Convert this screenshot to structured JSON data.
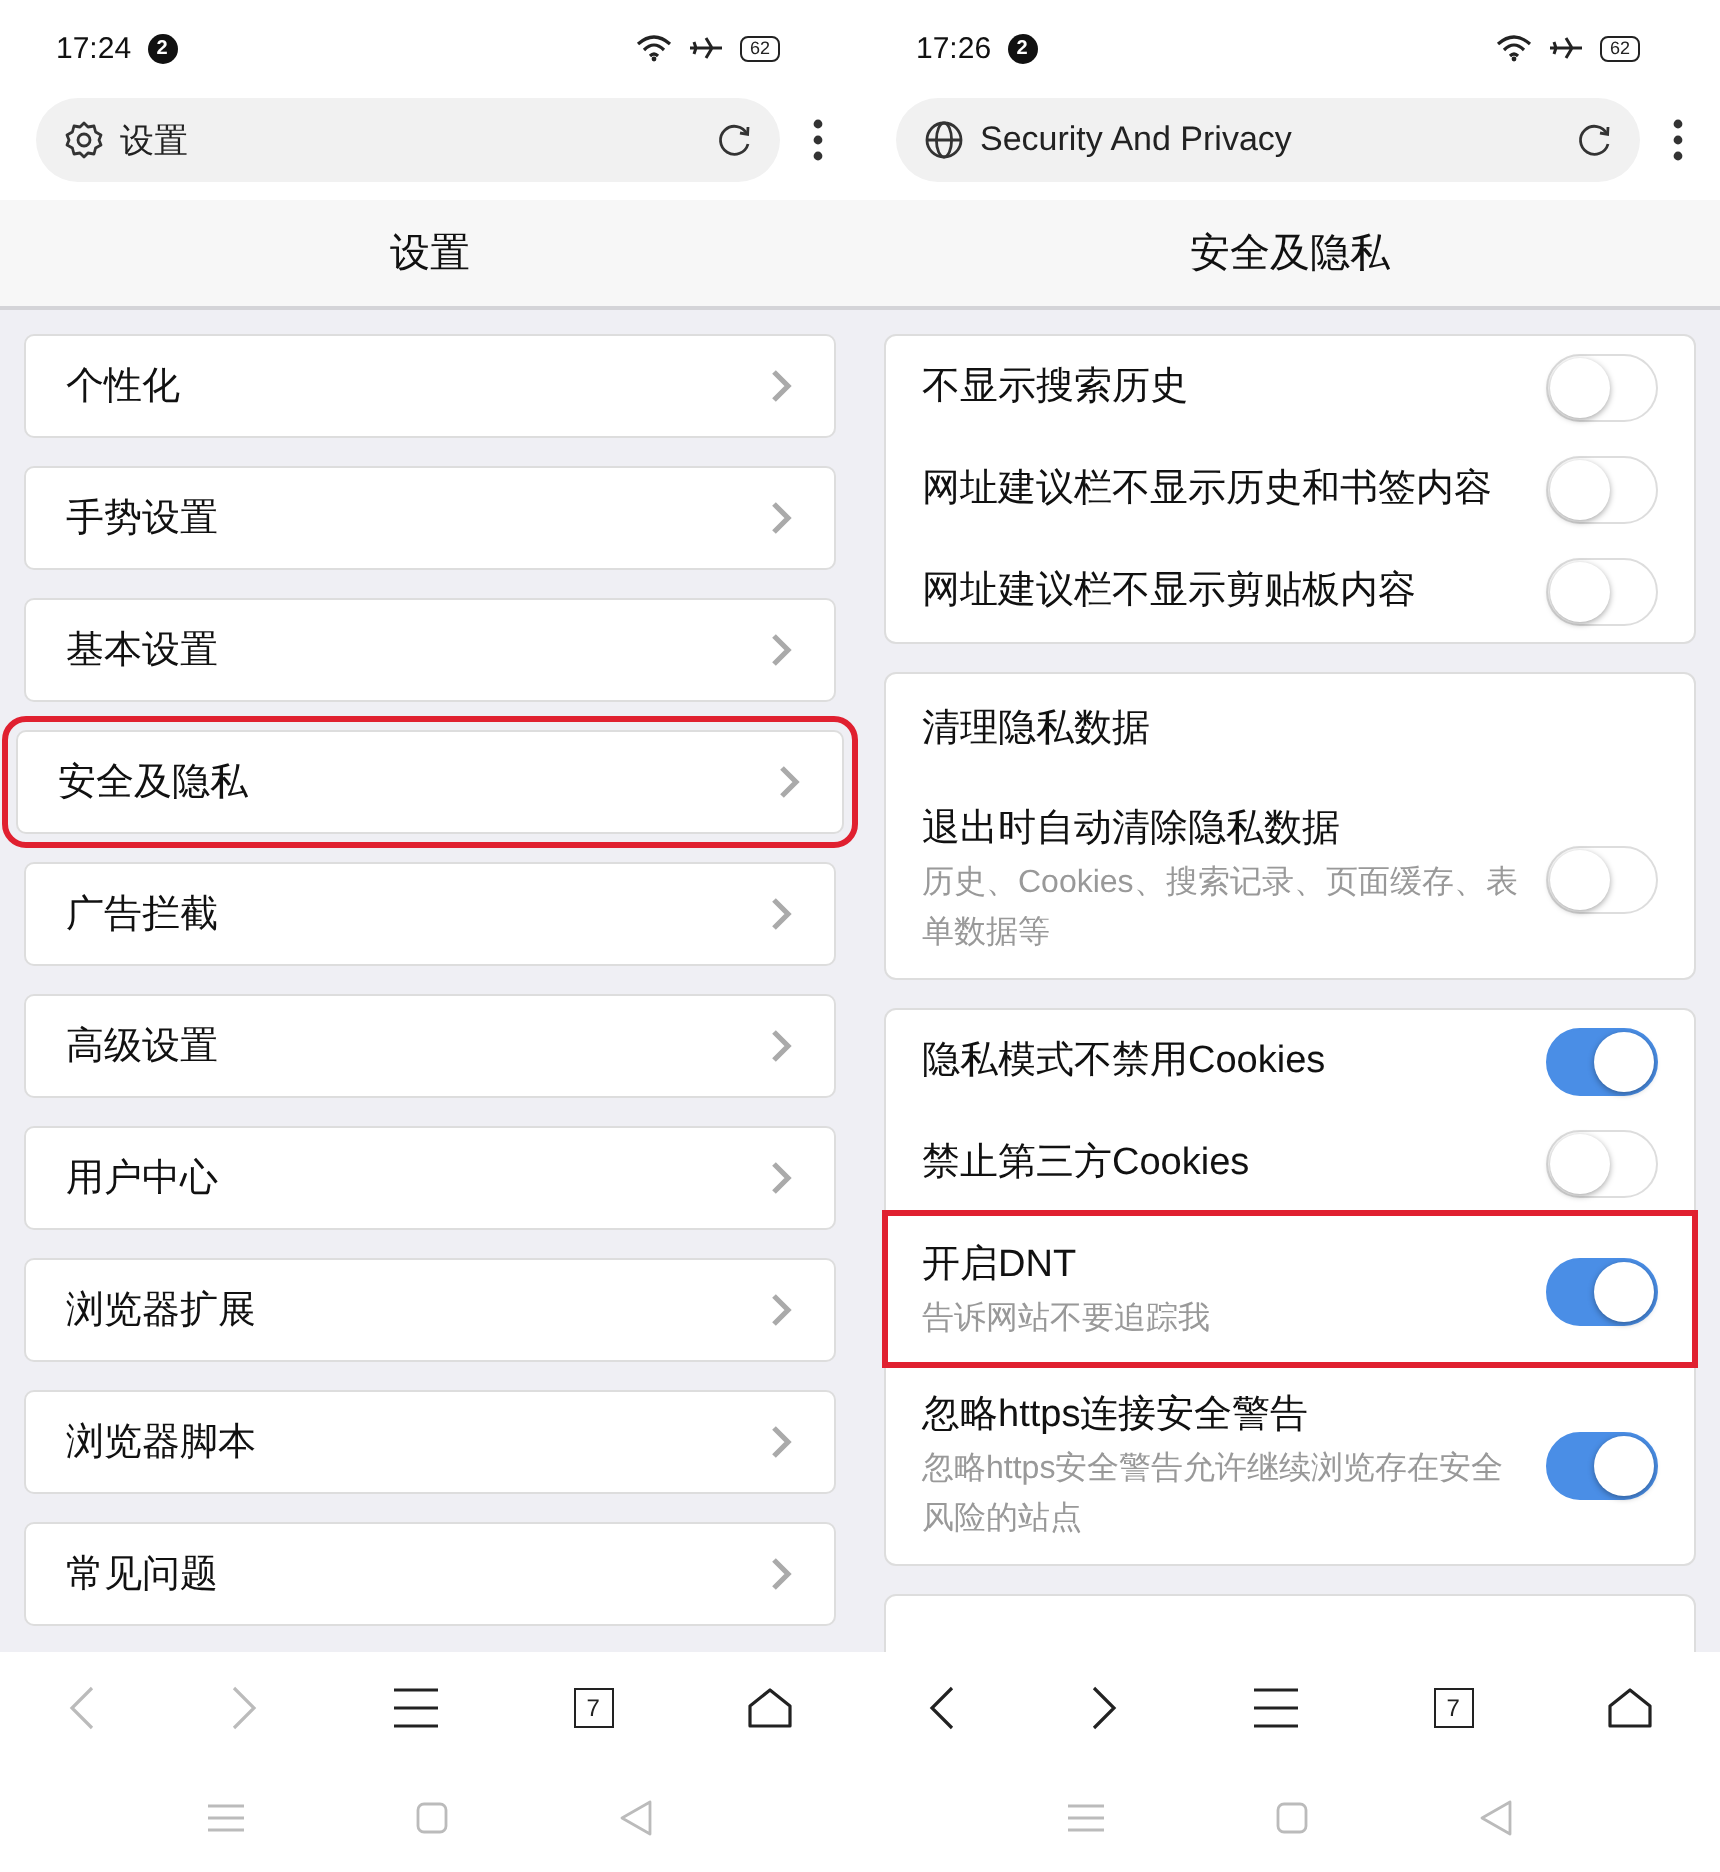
{
  "panels": [
    {
      "kind": "menu",
      "status_bar": {
        "time": "17:24",
        "notifications": "2",
        "battery": "62"
      },
      "address_bar": {
        "kind": "settings",
        "text": "设置"
      },
      "title": "设置",
      "menu_items": [
        {
          "label": "个性化",
          "highlighted": false
        },
        {
          "label": "手势设置",
          "highlighted": false
        },
        {
          "label": "基本设置",
          "highlighted": false
        },
        {
          "label": "安全及隐私",
          "highlighted": true
        },
        {
          "label": "广告拦截",
          "highlighted": false
        },
        {
          "label": "高级设置",
          "highlighted": false
        },
        {
          "label": "用户中心",
          "highlighted": false
        },
        {
          "label": "浏览器扩展",
          "highlighted": false
        },
        {
          "label": "浏览器脚本",
          "highlighted": false
        },
        {
          "label": "常见问题",
          "highlighted": false
        }
      ],
      "nav": {
        "back_enabled": false,
        "forward_enabled": false,
        "tab_count": "7"
      }
    },
    {
      "kind": "toggles",
      "status_bar": {
        "time": "17:26",
        "notifications": "2",
        "battery": "62"
      },
      "address_bar": {
        "kind": "web",
        "text": "Security And Privacy"
      },
      "title": "安全及隐私",
      "groups": [
        {
          "rows": [
            {
              "label": "不显示搜索历史",
              "on": false,
              "highlighted": false
            },
            {
              "label": "网址建议栏不显示历史和书签内容",
              "on": false,
              "highlighted": false
            },
            {
              "label": "网址建议栏不显示剪贴板内容",
              "on": false,
              "highlighted": false
            }
          ]
        },
        {
          "heading": "清理隐私数据",
          "rows": [
            {
              "label": "退出时自动清除隐私数据",
              "description": "历史、Cookies、搜索记录、页面缓存、表单数据等",
              "on": false,
              "highlighted": false
            }
          ]
        },
        {
          "rows": [
            {
              "label": "隐私模式不禁用Cookies",
              "on": true,
              "highlighted": false
            },
            {
              "label": "禁止第三方Cookies",
              "on": false,
              "highlighted": false
            },
            {
              "label": "开启DNT",
              "description": "告诉网站不要追踪我",
              "on": true,
              "highlighted": true
            },
            {
              "label": "忽略https连接安全警告",
              "description": "忽略https安全警告允许继续浏览存在安全风险的站点",
              "on": true,
              "highlighted": false
            }
          ]
        },
        {
          "kind": "partial"
        }
      ],
      "nav": {
        "back_enabled": true,
        "forward_enabled": true,
        "tab_count": "7"
      }
    }
  ]
}
